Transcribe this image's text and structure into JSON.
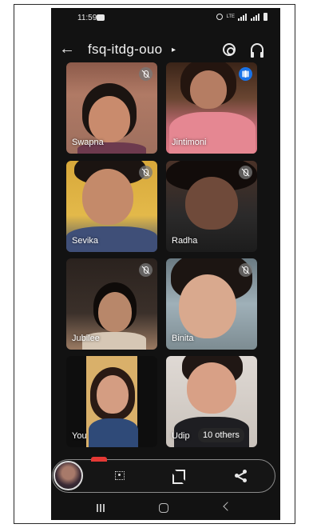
{
  "status_bar": {
    "time": "11:59",
    "network": "LTE"
  },
  "header": {
    "meeting_code": "fsq-itdg-ouo",
    "caret": "▸"
  },
  "participants": [
    {
      "name": "Swapna",
      "muted": true,
      "speaking": false
    },
    {
      "name": "Jintimoni",
      "muted": false,
      "speaking": true
    },
    {
      "name": "Sevika",
      "muted": true,
      "speaking": false
    },
    {
      "name": "Radha",
      "muted": true,
      "speaking": false
    },
    {
      "name": "Jubilee",
      "muted": true,
      "speaking": false
    },
    {
      "name": "Binita",
      "muted": true,
      "speaking": false
    },
    {
      "name": "You",
      "muted": false,
      "speaking": false
    },
    {
      "name": "Udip",
      "muted": false,
      "speaking": false
    }
  ],
  "others_badge": "10 others",
  "toolbar": {
    "icons": [
      "self-view",
      "end-call",
      "focus",
      "flip-camera",
      "share"
    ]
  },
  "nav_bar": {
    "icons": [
      "recents",
      "home",
      "back"
    ]
  },
  "colors": {
    "background": "#121212",
    "speaking_accent": "#1a73e8",
    "end_call": "#e53935"
  }
}
